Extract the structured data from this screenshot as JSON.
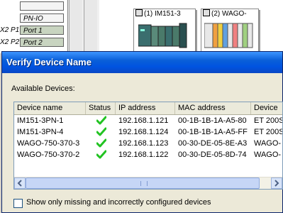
{
  "background": {
    "tree_rows": [
      {
        "prefix": "",
        "label": ""
      },
      {
        "prefix": "",
        "label": "PN-IO"
      },
      {
        "prefix": "X2 P1",
        "label": "Port 1"
      },
      {
        "prefix": "X2 P2",
        "label": "Port 2"
      }
    ],
    "devices": [
      {
        "title": "(1) IM151-3"
      },
      {
        "title": "(2) WAGO-"
      }
    ]
  },
  "dialog": {
    "title": "Verify Device Name",
    "available_label": "Available Devices:",
    "columns": [
      "Device name",
      "Status",
      "IP address",
      "MAC address",
      "Device"
    ],
    "rows": [
      {
        "name": "IM151-3PN-1",
        "status": "ok",
        "ip": "192.168.1.121",
        "mac": "00-1B-1B-1A-A5-80",
        "device": "ET 200S"
      },
      {
        "name": "IM151-3PN-4",
        "status": "ok",
        "ip": "192.168.1.124",
        "mac": "00-1B-1B-1A-A5-FF",
        "device": "ET 200S"
      },
      {
        "name": "WAGO-750-370-3",
        "status": "ok",
        "ip": "192.168.1.123",
        "mac": "00-30-DE-05-8E-A3",
        "device": "WAGO-"
      },
      {
        "name": "WAGO-750-370-2",
        "status": "ok",
        "ip": "192.168.1.122",
        "mac": "00-30-DE-05-8D-74",
        "device": "WAGO-"
      }
    ],
    "checkbox_label": "Show only missing and incorrectly configured devices",
    "checkbox_checked": false
  },
  "colors": {
    "titlebar": "#0a5fd8",
    "check_green": "#22c322"
  }
}
